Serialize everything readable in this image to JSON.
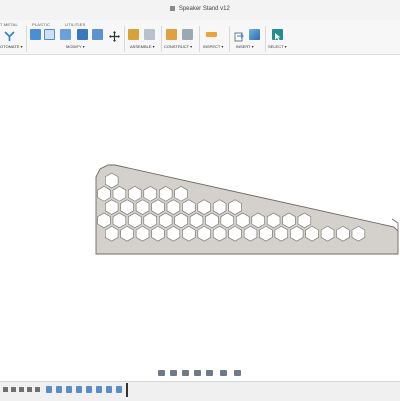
{
  "window": {
    "title": "Speaker Stand v12"
  },
  "toolbar": {
    "tabs": [
      "T METAL",
      "PLASTIC",
      "UTILITIES"
    ],
    "groups": [
      "OTOMATE ▾",
      "MODIFY ▾",
      "ASSEMBLE ▾",
      "CONSTRUCT ▾",
      "INSPECT ▾",
      "INSERT ▾",
      "SELECT ▾"
    ],
    "accent_color": "#2b7fd0"
  },
  "colors": {
    "part_fill": "#d4d0cc",
    "part_edge": "#6f6a66",
    "timeline_feature": "#5b8cc4"
  },
  "canvas": {
    "model": "speaker-stand-hex-panel"
  }
}
